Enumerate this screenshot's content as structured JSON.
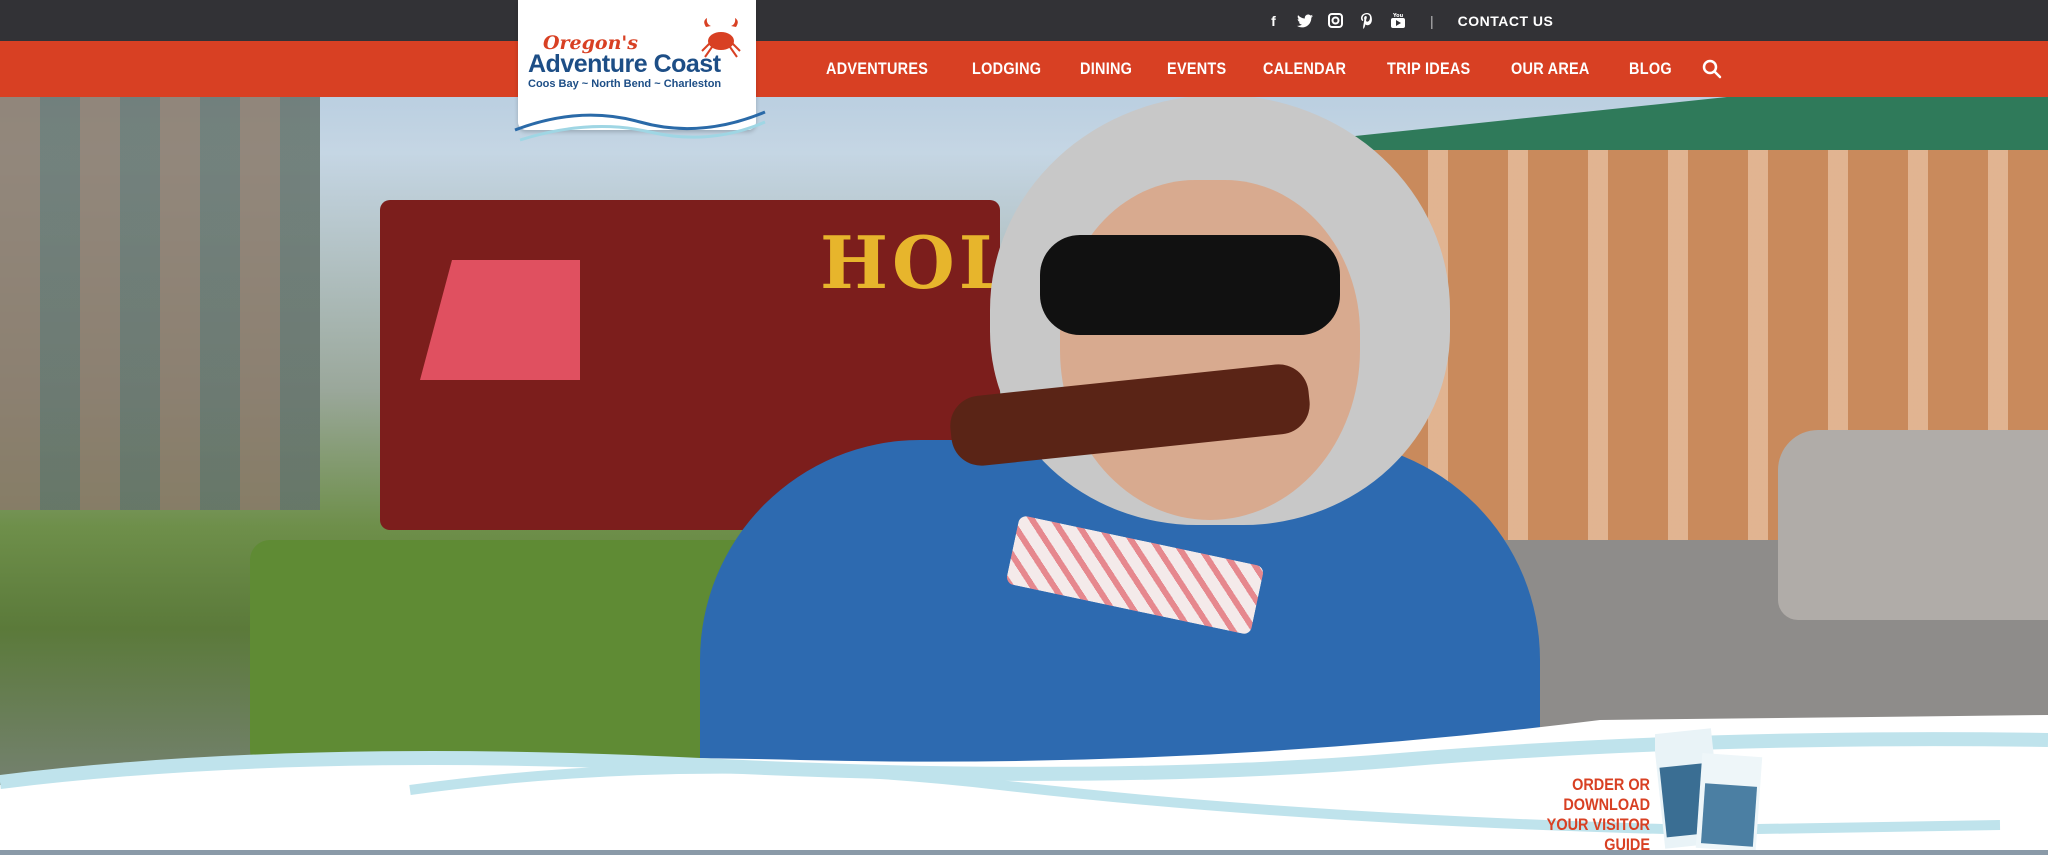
{
  "utility_bar": {
    "social_icons": [
      {
        "name": "facebook-icon",
        "glyph": "f"
      },
      {
        "name": "twitter-icon",
        "glyph": "t"
      },
      {
        "name": "instagram-icon",
        "glyph": "◘"
      },
      {
        "name": "pinterest-icon",
        "glyph": "p"
      },
      {
        "name": "youtube-icon",
        "glyph": "▶"
      }
    ],
    "separator": "|",
    "contact_label": "CONTACT US"
  },
  "logo": {
    "script": "Oregon's",
    "main": "Adventure Coast",
    "sub": "Coos Bay ~ North Bend ~ Charleston"
  },
  "nav": {
    "items": [
      "ADVENTURES",
      "LODGING",
      "DINING",
      "EVENTS",
      "CALENDAR",
      "TRIP IDEAS",
      "OUR AREA",
      "BLOG"
    ]
  },
  "hero": {
    "truck_sign": "HOL"
  },
  "visitor_guide": {
    "line1": "ORDER OR DOWNLOAD",
    "line2": "YOUR VISITOR GUIDE"
  },
  "colors": {
    "brand_orange": "#d84023",
    "dark_bar": "#323236",
    "brand_blue": "#1d4e86"
  }
}
